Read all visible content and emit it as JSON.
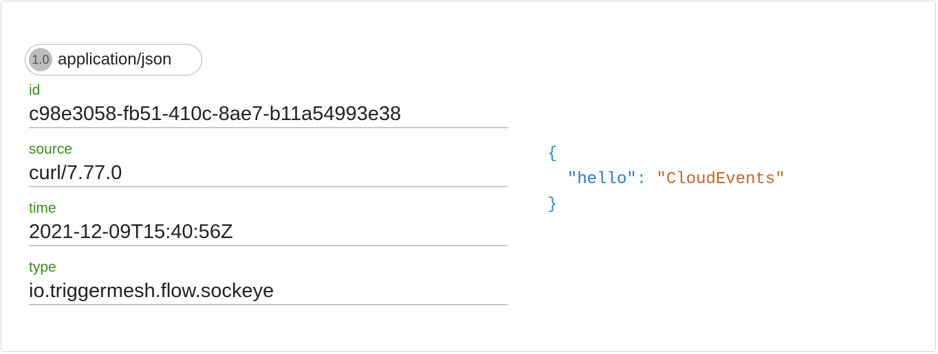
{
  "event": {
    "spec_version": "1.0",
    "content_type": "application/json",
    "fields": [
      {
        "label": "id",
        "value": "c98e3058-fb51-410c-8ae7-b11a54993e38"
      },
      {
        "label": "source",
        "value": "curl/7.77.0"
      },
      {
        "label": "time",
        "value": "2021-12-09T15:40:56Z"
      },
      {
        "label": "type",
        "value": "io.triggermesh.flow.sockeye"
      }
    ],
    "payload": {
      "open_brace": "{",
      "key": "\"hello\"",
      "colon": ": ",
      "value": "\"CloudEvents\"",
      "close_brace": "}"
    }
  },
  "colors": {
    "label_green": "#3a8a1e",
    "json_key_blue": "#2f77c8",
    "json_punct_blue": "#2d8fc4",
    "json_string_orange": "#c0662a",
    "badge_gray": "#bdbdbd"
  }
}
